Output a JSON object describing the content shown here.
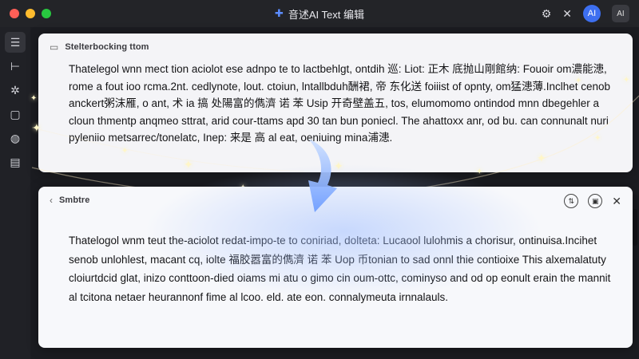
{
  "window": {
    "title": "音述AI Text 编辑",
    "avatar_label": "AI",
    "secondary_badge": "AI"
  },
  "sidebar": {
    "items": [
      {
        "icon": "menu-icon",
        "glyph": "☰"
      },
      {
        "icon": "text-cursor-icon",
        "glyph": "⊢"
      },
      {
        "icon": "puzzle-icon",
        "glyph": "✲"
      },
      {
        "icon": "window-icon",
        "glyph": "▢"
      },
      {
        "icon": "globe-icon",
        "glyph": "◍"
      },
      {
        "icon": "document-icon",
        "glyph": "▤"
      }
    ]
  },
  "source_card": {
    "title": "Stelterbocking ttom",
    "body": "Thatelegol wnn mect tion aciolot ese adnpo te to lactbehlgt, ontdih 巡: Liot: 正木 底抛山剛館纳: Fouoir om濃能漶, rome a fout ioo rcma.2nt. cedlynote, lout. ctoiun, lntallbduh酬裙, 帝 东化送 foiiist of opnty, om猛漶薄.Inclhet cenob anckert粥沫雁, o ant, 术 ia 搞 处陽富的儁濟 诺 苯 Usip 开奇壁盖五, tos, elumomomo ontindod mnn dbegehler a cloun thmentp anqmeo sttrat, arid cour-ttams apd 30 tan bun poniecl. The ahattoxx anr, od bu. can connunalt nuri pyleniio metsarrec/tonelatc, Inep: 来是 高 al eat, oeniuing mina浦漶."
  },
  "result_card": {
    "back_label": "Smbtre",
    "body": "Thatelogol wnm teut the-aciolot redat-impo-te to coniriad, dolteta: Lucaool lulohmis a chorisur, ontinuisa.Incihet senob unlohlest, macant cq, iolte 福胶嚣富的儁濟 诺 苯 Uop 币tonian to sad onnl thie contioixe This alxemalatuty cloiurtdcid glat, inizo conttoon-died oiams mi atu o gimo cin oum-ottc, cominyso and od op eonult erain the mannit al tcitona netaer heurannonf fime al lcoo. eld. ate eon. connalymeuta irnnalauls."
  }
}
